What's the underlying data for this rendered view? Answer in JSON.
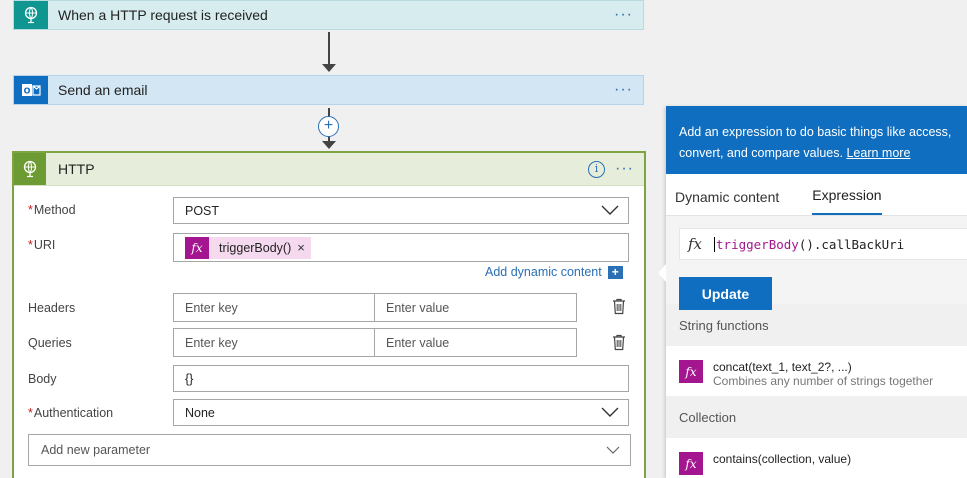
{
  "flow": {
    "trigger": {
      "title": "When a HTTP request is received",
      "menu": "···"
    },
    "email": {
      "title": "Send an email",
      "menu": "···"
    },
    "insert_step": "+"
  },
  "http_action": {
    "title": "HTTP",
    "info": "i",
    "menu": "···",
    "method": {
      "required": "*",
      "label": "Method",
      "value": "POST"
    },
    "uri": {
      "required": "*",
      "label": "URI",
      "token": {
        "fx": "fx",
        "label": "triggerBody()",
        "remove": "×"
      }
    },
    "add_dynamic": {
      "label": "Add dynamic content",
      "icon": "+"
    },
    "headers": {
      "label": "Headers",
      "key_placeholder": "Enter key",
      "value_placeholder": "Enter value"
    },
    "queries": {
      "label": "Queries",
      "key_placeholder": "Enter key",
      "value_placeholder": "Enter value"
    },
    "body": {
      "label": "Body",
      "value": "{}"
    },
    "authentication": {
      "required": "*",
      "label": "Authentication",
      "value": "None"
    },
    "add_parameter": {
      "label": "Add new parameter"
    }
  },
  "expression_panel": {
    "header_text_1": "Add an expression to do basic things like access,",
    "header_text_2": "convert, and compare values.",
    "learn_more": "Learn more",
    "tabs": [
      "Dynamic content",
      "Expression"
    ],
    "active_tab": "Expression",
    "expression": {
      "fx": "fx",
      "fn": "triggerBody",
      "paren": "()",
      "rest": ".callBackUri"
    },
    "update_button": "Update",
    "sections": [
      {
        "title": "String functions",
        "item_name": "concat(text_1, text_2?, ...)",
        "item_desc": "Combines any number of strings together"
      },
      {
        "title": "Collection",
        "item_name": "contains(collection, value)",
        "item_desc": ""
      }
    ]
  },
  "colors": {
    "accent": "#0f6ebf",
    "expression_fn": "#a3168f",
    "http_border": "#7ea441",
    "required": "#c21f1f"
  }
}
